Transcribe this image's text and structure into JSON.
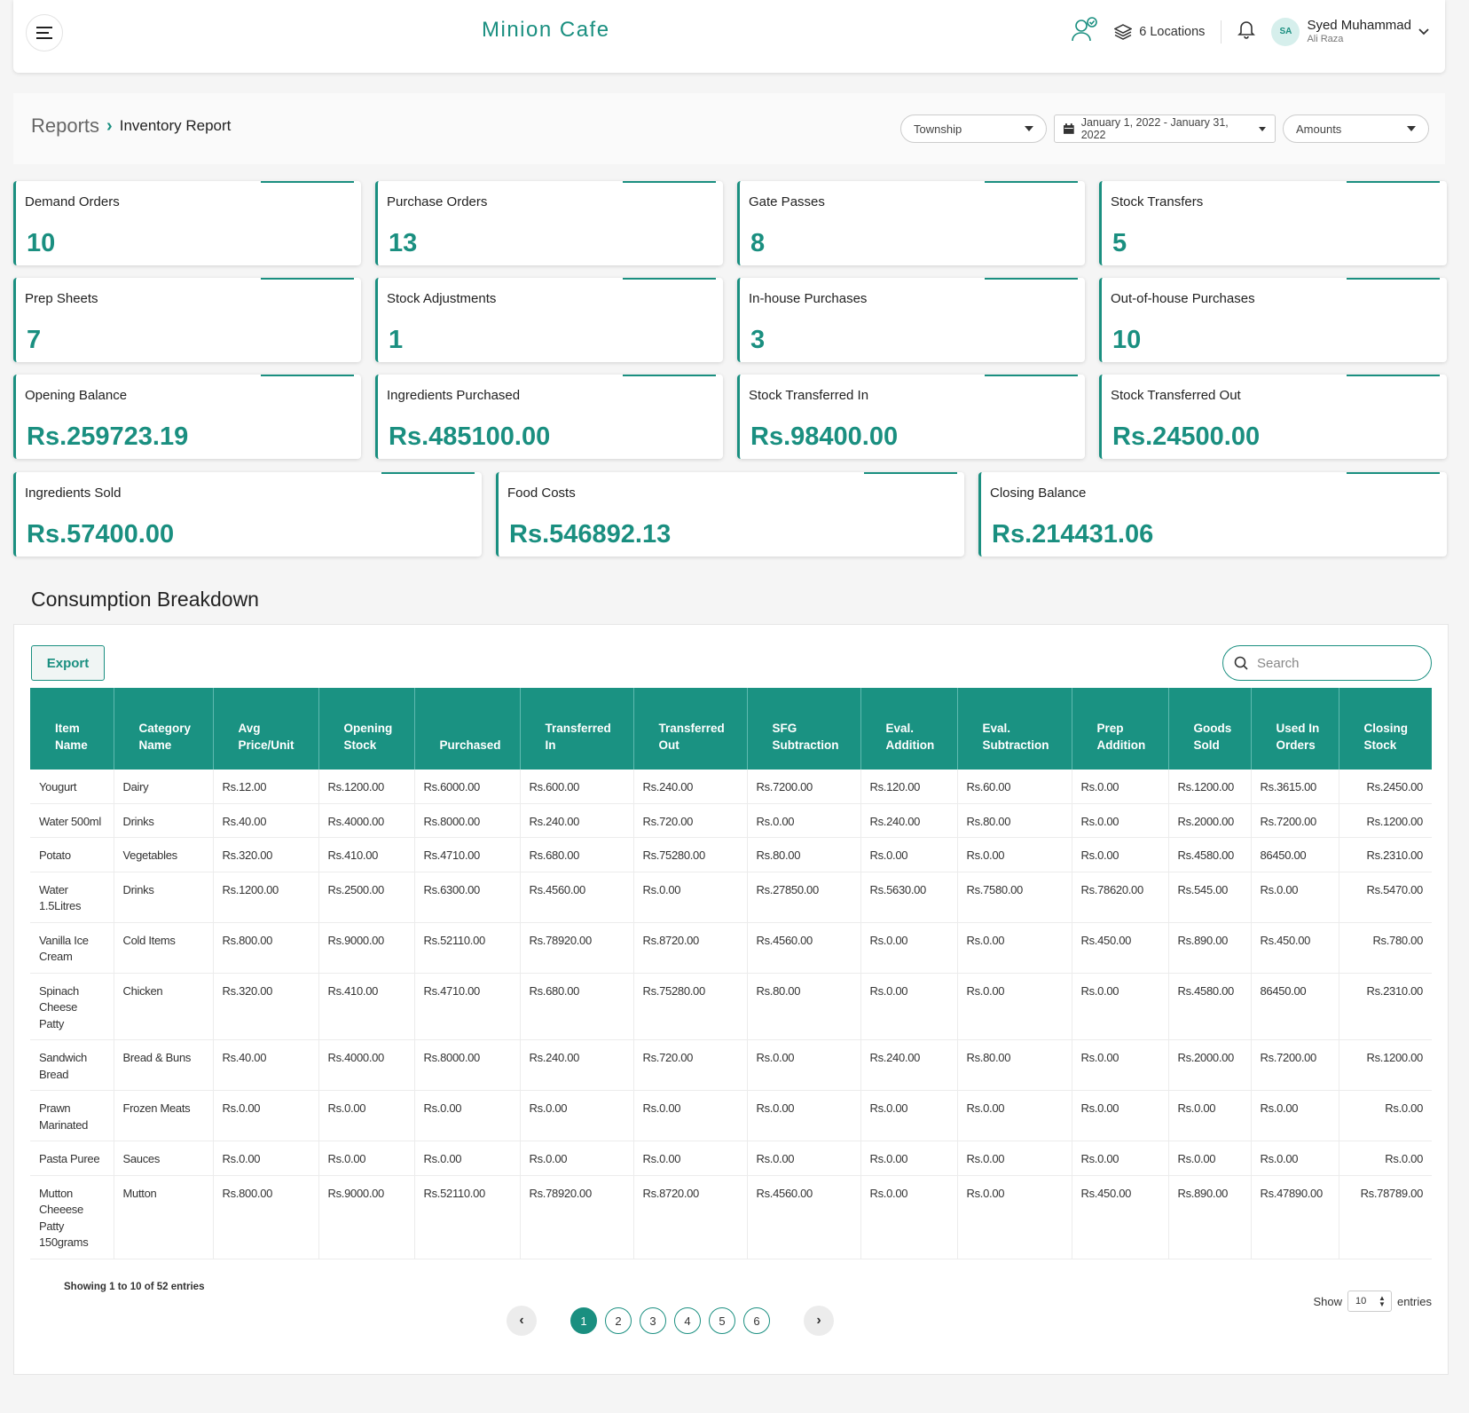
{
  "header": {
    "brand": "Minion Cafe",
    "locations": "6 Locations",
    "avatar_initials": "SA",
    "user_name": "Syed Muhammad",
    "user_sub": "Ali Raza"
  },
  "breadcrumb": {
    "root": "Reports",
    "current": "Inventory Report"
  },
  "filters": {
    "township": "Township",
    "date_range": "January 1, 2022 - January 31, 2022",
    "mode": "Amounts"
  },
  "stats": [
    {
      "label": "Demand Orders",
      "value": "10"
    },
    {
      "label": "Purchase Orders",
      "value": "13"
    },
    {
      "label": "Gate Passes",
      "value": "8"
    },
    {
      "label": "Stock Transfers",
      "value": "5"
    },
    {
      "label": "Prep Sheets",
      "value": "7"
    },
    {
      "label": "Stock Adjustments",
      "value": "1"
    },
    {
      "label": "In-house Purchases",
      "value": "3"
    },
    {
      "label": "Out-of-house Purchases",
      "value": "10"
    },
    {
      "label": "Opening Balance",
      "value": "Rs.259723.19"
    },
    {
      "label": "Ingredients Purchased",
      "value": "Rs.485100.00"
    },
    {
      "label": "Stock Transferred In",
      "value": "Rs.98400.00"
    },
    {
      "label": "Stock Transferred Out",
      "value": "Rs.24500.00"
    },
    {
      "label": "Ingredients Sold",
      "value": "Rs.57400.00"
    },
    {
      "label": "Food Costs",
      "value": "Rs.546892.13"
    },
    {
      "label": "Closing Balance",
      "value": "Rs.214431.06"
    }
  ],
  "section_title": "Consumption Breakdown",
  "export_label": "Export",
  "search_placeholder": "Search",
  "table": {
    "columns": [
      "Item Name",
      "Category Name",
      "Avg Price/Unit",
      "Opening Stock",
      "Purchased",
      "Transferred In",
      "Transferred Out",
      "SFG Subtraction",
      "Eval. Addition",
      "Eval. Subtraction",
      "Prep Addition",
      "Goods Sold",
      "Used In Orders",
      "Closing Stock"
    ],
    "rows": [
      [
        "Yougurt",
        "Dairy",
        "Rs.12.00",
        "Rs.1200.00",
        "Rs.6000.00",
        "Rs.600.00",
        "Rs.240.00",
        "Rs.7200.00",
        "Rs.120.00",
        "Rs.60.00",
        "Rs.0.00",
        "Rs.1200.00",
        "Rs.3615.00",
        "Rs.2450.00"
      ],
      [
        "Water 500ml",
        "Drinks",
        "Rs.40.00",
        "Rs.4000.00",
        "Rs.8000.00",
        "Rs.240.00",
        "Rs.720.00",
        "Rs.0.00",
        "Rs.240.00",
        "Rs.80.00",
        "Rs.0.00",
        "Rs.2000.00",
        "Rs.7200.00",
        "Rs.1200.00"
      ],
      [
        "Potato",
        "Vegetables",
        "Rs.320.00",
        "Rs.410.00",
        "Rs.4710.00",
        "Rs.680.00",
        "Rs.75280.00",
        "Rs.80.00",
        "Rs.0.00",
        "Rs.0.00",
        "Rs.0.00",
        "Rs.4580.00",
        "86450.00",
        "Rs.2310.00"
      ],
      [
        "Water 1.5Litres",
        "Drinks",
        "Rs.1200.00",
        "Rs.2500.00",
        "Rs.6300.00",
        "Rs.4560.00",
        "Rs.0.00",
        "Rs.27850.00",
        "Rs.5630.00",
        "Rs.7580.00",
        "Rs.78620.00",
        "Rs.545.00",
        "Rs.0.00",
        "Rs.5470.00"
      ],
      [
        "Vanilla Ice Cream",
        "Cold Items",
        "Rs.800.00",
        "Rs.9000.00",
        "Rs.52110.00",
        "Rs.78920.00",
        "Rs.8720.00",
        "Rs.4560.00",
        "Rs.0.00",
        "Rs.0.00",
        "Rs.450.00",
        "Rs.890.00",
        "Rs.450.00",
        "Rs.780.00"
      ],
      [
        "Spinach Cheese Patty",
        "Chicken",
        "Rs.320.00",
        "Rs.410.00",
        "Rs.4710.00",
        "Rs.680.00",
        "Rs.75280.00",
        "Rs.80.00",
        "Rs.0.00",
        "Rs.0.00",
        "Rs.0.00",
        "Rs.4580.00",
        "86450.00",
        "Rs.2310.00"
      ],
      [
        "Sandwich Bread",
        "Bread & Buns",
        "Rs.40.00",
        "Rs.4000.00",
        "Rs.8000.00",
        "Rs.240.00",
        "Rs.720.00",
        "Rs.0.00",
        "Rs.240.00",
        "Rs.80.00",
        "Rs.0.00",
        "Rs.2000.00",
        "Rs.7200.00",
        "Rs.1200.00"
      ],
      [
        "Prawn Marinated",
        "Frozen Meats",
        "Rs.0.00",
        "Rs.0.00",
        "Rs.0.00",
        "Rs.0.00",
        "Rs.0.00",
        "Rs.0.00",
        "Rs.0.00",
        "Rs.0.00",
        "Rs.0.00",
        "Rs.0.00",
        "Rs.0.00",
        "Rs.0.00"
      ],
      [
        "Pasta Puree",
        "Sauces",
        "Rs.0.00",
        "Rs.0.00",
        "Rs.0.00",
        "Rs.0.00",
        "Rs.0.00",
        "Rs.0.00",
        "Rs.0.00",
        "Rs.0.00",
        "Rs.0.00",
        "Rs.0.00",
        "Rs.0.00",
        "Rs.0.00"
      ],
      [
        "Mutton Cheeese Patty 150grams",
        "Mutton",
        "Rs.800.00",
        "Rs.9000.00",
        "Rs.52110.00",
        "Rs.78920.00",
        "Rs.8720.00",
        "Rs.4560.00",
        "Rs.0.00",
        "Rs.0.00",
        "Rs.450.00",
        "Rs.890.00",
        "Rs.47890.00",
        "Rs.78789.00"
      ]
    ]
  },
  "footer": {
    "showing": "Showing 1 to 10 of 52 entries",
    "pages": [
      "1",
      "2",
      "3",
      "4",
      "5",
      "6"
    ],
    "active_page": "1",
    "show_label": "Show",
    "per_page": "10",
    "entries_label": "entries"
  },
  "colors": {
    "accent": "#1a8f80",
    "header_bg": "#1a9282"
  }
}
